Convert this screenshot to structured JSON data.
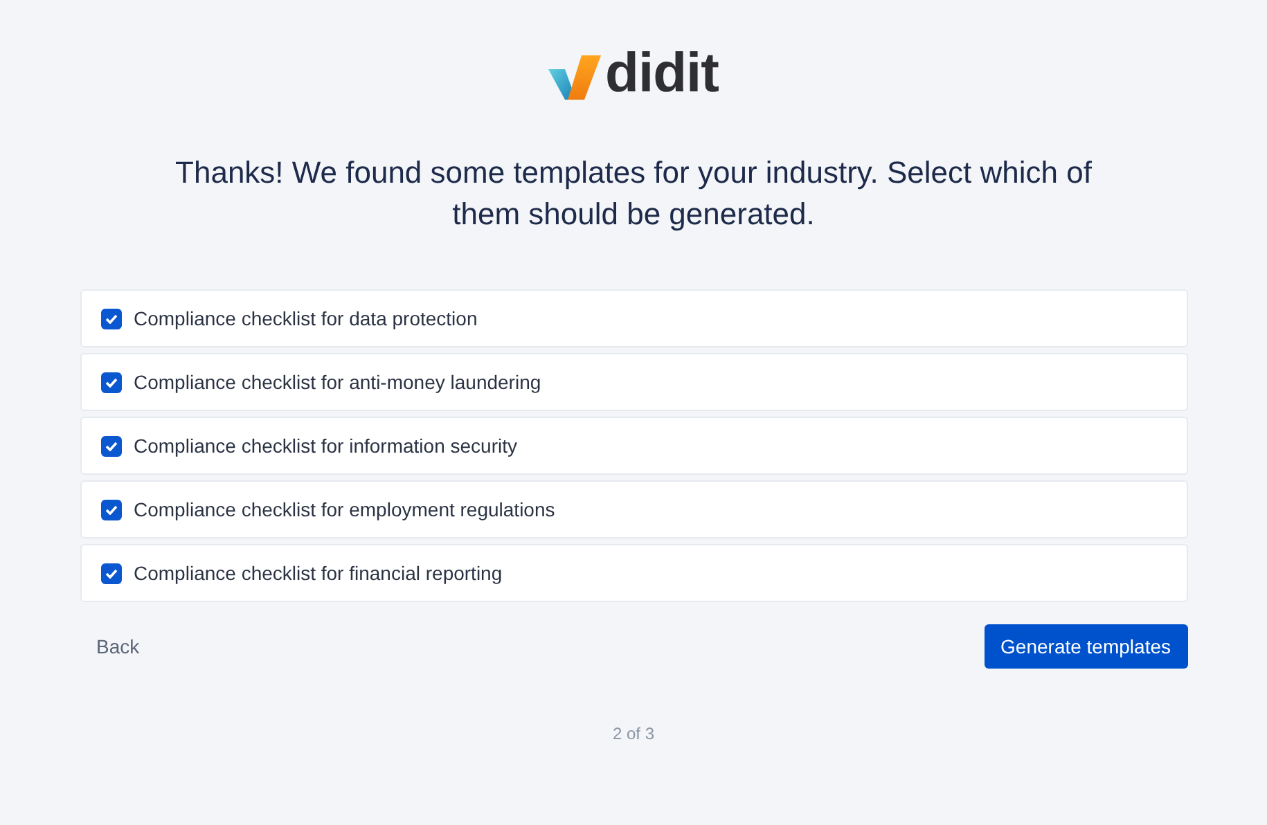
{
  "logo": {
    "text": "didit"
  },
  "heading": "Thanks! We found some templates for your industry. Select which of them should be generated.",
  "templates": [
    {
      "label": "Compliance checklist for data protection",
      "checked": true
    },
    {
      "label": "Compliance checklist for anti-money laundering",
      "checked": true
    },
    {
      "label": "Compliance checklist for information security",
      "checked": true
    },
    {
      "label": "Compliance checklist for employment regulations",
      "checked": true
    },
    {
      "label": "Compliance checklist for financial reporting",
      "checked": true
    }
  ],
  "back_button": "Back",
  "generate_button": "Generate templates",
  "step": "2 of 3"
}
